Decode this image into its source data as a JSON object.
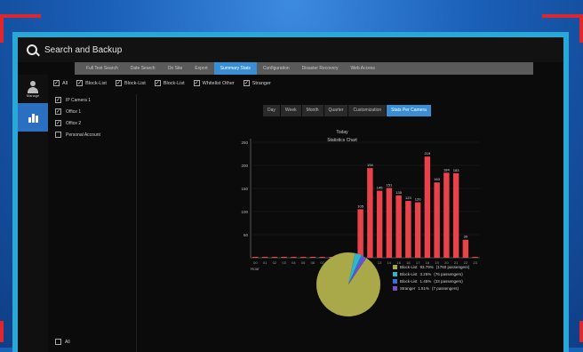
{
  "window": {
    "title": "Search and Backup"
  },
  "tabs": [
    {
      "label": "Full Text Search",
      "active": false
    },
    {
      "label": "Date Search",
      "active": false
    },
    {
      "label": "On Site",
      "active": false
    },
    {
      "label": "Export",
      "active": false
    },
    {
      "label": "Summary Stats",
      "active": true
    },
    {
      "label": "Configuration",
      "active": false
    },
    {
      "label": "Disaster Recovery",
      "active": false
    },
    {
      "label": "Web Access",
      "active": false
    }
  ],
  "sidebar": [
    {
      "label": "Manage",
      "icon": "person-icon",
      "active": false
    },
    {
      "label": "",
      "icon": "bar-chart-icon",
      "active": true
    }
  ],
  "filters": [
    {
      "label": "All",
      "checked": true
    },
    {
      "label": "Block-List",
      "checked": true
    },
    {
      "label": "Block-List",
      "checked": true
    },
    {
      "label": "Block-List",
      "checked": true
    },
    {
      "label": "Whitelist Other",
      "checked": true
    },
    {
      "label": "Stranger",
      "checked": true
    }
  ],
  "left_panel": {
    "items": [
      {
        "label": "IP Camera 1",
        "checked": true
      },
      {
        "label": "Office 1",
        "checked": true
      },
      {
        "label": "Office 2",
        "checked": true
      },
      {
        "label": "Personal Account",
        "checked": false
      }
    ],
    "footer": {
      "label": "All",
      "checked": false
    }
  },
  "subtabs": [
    {
      "label": "Day",
      "active": false
    },
    {
      "label": "Week",
      "active": false
    },
    {
      "label": "Month",
      "active": false
    },
    {
      "label": "Quarter",
      "active": false
    },
    {
      "label": "Customization",
      "active": false
    },
    {
      "label": "Stats Per Camera",
      "active": true
    }
  ],
  "chart_header": {
    "period": "Today",
    "title": "Statistics Chart"
  },
  "chart_data": [
    {
      "type": "bar",
      "categories": [
        "00",
        "01",
        "02",
        "03",
        "04",
        "05",
        "06",
        "07",
        "08",
        "09",
        "10",
        "11",
        "12",
        "13",
        "14",
        "15",
        "16",
        "17",
        "18",
        "19",
        "20",
        "21",
        "22",
        "23"
      ],
      "values": [
        0,
        0,
        0,
        0,
        0,
        0,
        0,
        0,
        0,
        0,
        0,
        105,
        194,
        145,
        151,
        135,
        123,
        120,
        219,
        163,
        184,
        183,
        39,
        0
      ],
      "data_labels": [
        "",
        "",
        "",
        "",
        "",
        "",
        "",
        "",
        "",
        "",
        "",
        "105",
        "194",
        "145",
        "151",
        "135",
        "123",
        "120",
        "219",
        "163",
        "184",
        "183",
        "39",
        ""
      ],
      "yticks": [
        "50",
        "100",
        "150",
        "200",
        "250"
      ],
      "xlabel": "Hour",
      "ylim": [
        0,
        250
      ],
      "color": "#e8424a"
    },
    {
      "type": "pie",
      "slices": [
        {
          "label": "Block-List",
          "value": 93.79,
          "text": "93.79%",
          "count": "(1760 passengers)",
          "color": "#a9a94a"
        },
        {
          "label": "Block-List",
          "value": 3.25,
          "text": "3.25%",
          "count": "(76 passengers)",
          "color": "#2fb6c8"
        },
        {
          "label": "Block-List",
          "value": 1.45,
          "text": "1.45%",
          "count": "(33 passengers)",
          "color": "#3a6fd8"
        },
        {
          "label": "Stranger",
          "value": 1.51,
          "text": "1.51%",
          "count": "(7 passengers)",
          "color": "#7a4fc8"
        }
      ]
    }
  ],
  "colors": {
    "accent": "#3a8fd4",
    "frame": "#29a8d8",
    "corner": "#e0252d"
  }
}
